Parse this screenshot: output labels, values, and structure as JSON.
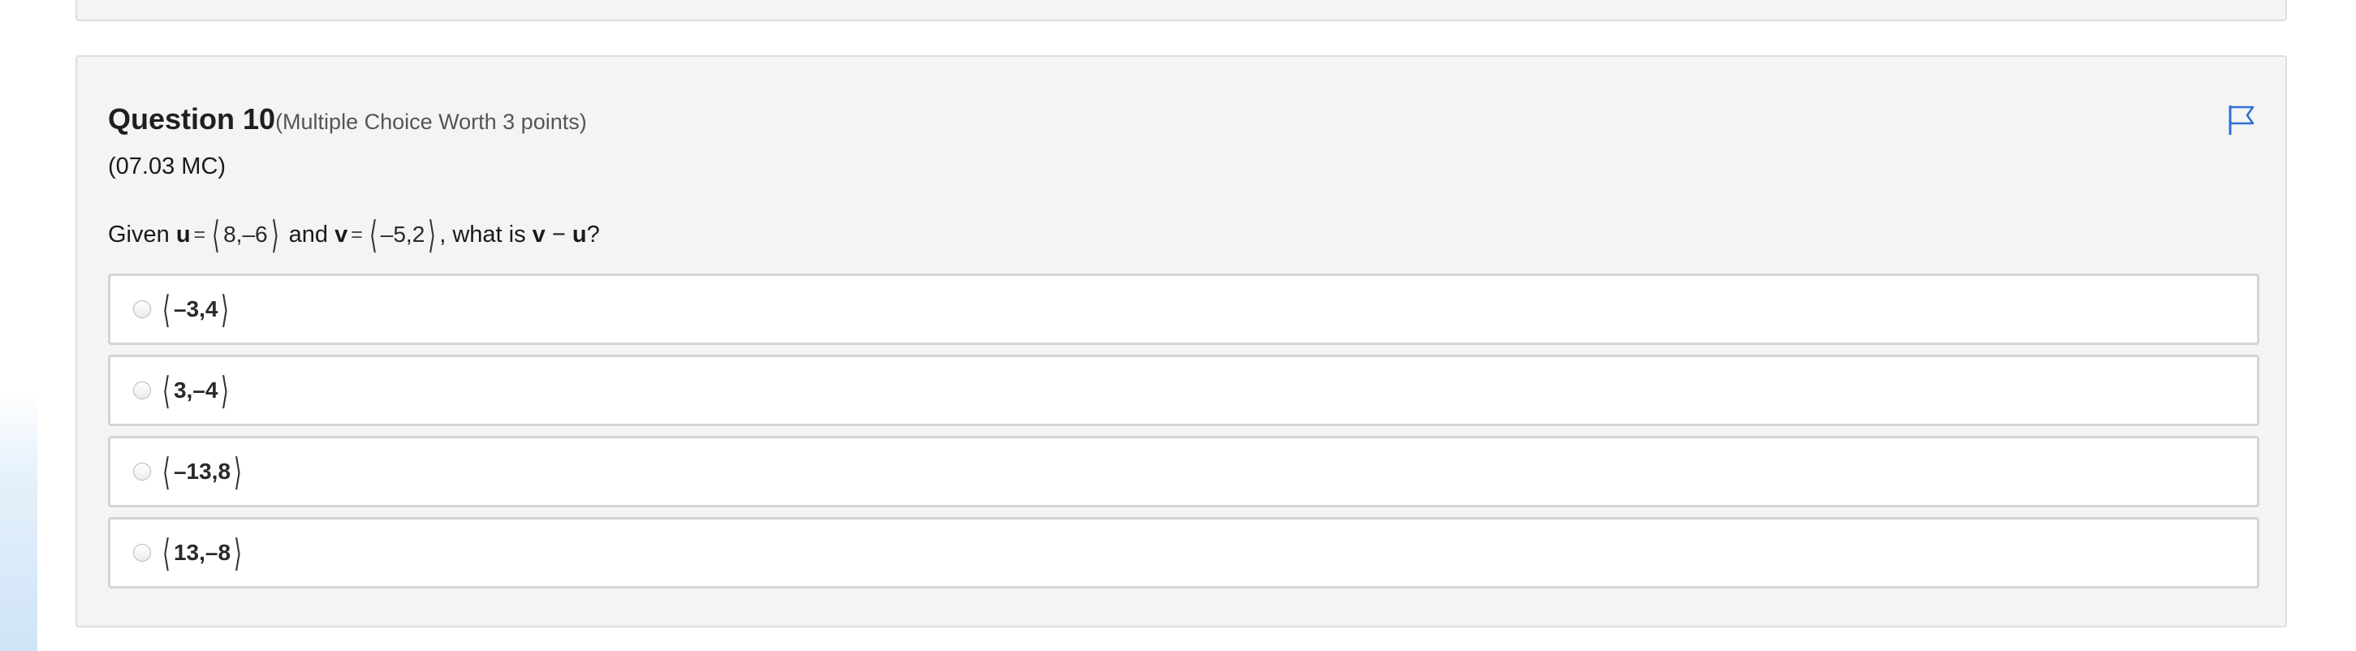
{
  "question": {
    "title": "Question 10",
    "meta": "(Multiple Choice Worth 3 points)",
    "code": "(07.03 MC)",
    "stem": {
      "prefix": "Given ",
      "u_var": "u",
      "equals": "=",
      "u_value": "8,–6",
      "and_text": " and ",
      "v_var": "v",
      "v_value": "–5,2",
      "mid_text": ", what is ",
      "expr_v": "v",
      "minus": " − ",
      "expr_u": "u",
      "suffix": "?"
    },
    "brackets": {
      "open": "⟨",
      "close": "⟩"
    },
    "choices": [
      {
        "value": "–3,4",
        "selected": false
      },
      {
        "value": "3,–4",
        "selected": false
      },
      {
        "value": "–13,8",
        "selected": false
      },
      {
        "value": "13,–8",
        "selected": false
      }
    ]
  },
  "icons": {
    "flag": "flag-icon"
  },
  "colors": {
    "flag": "#2f6fd6",
    "card_bg": "#f4f4f4",
    "card_border": "#dedede",
    "choice_border": "#d4d4d4"
  }
}
